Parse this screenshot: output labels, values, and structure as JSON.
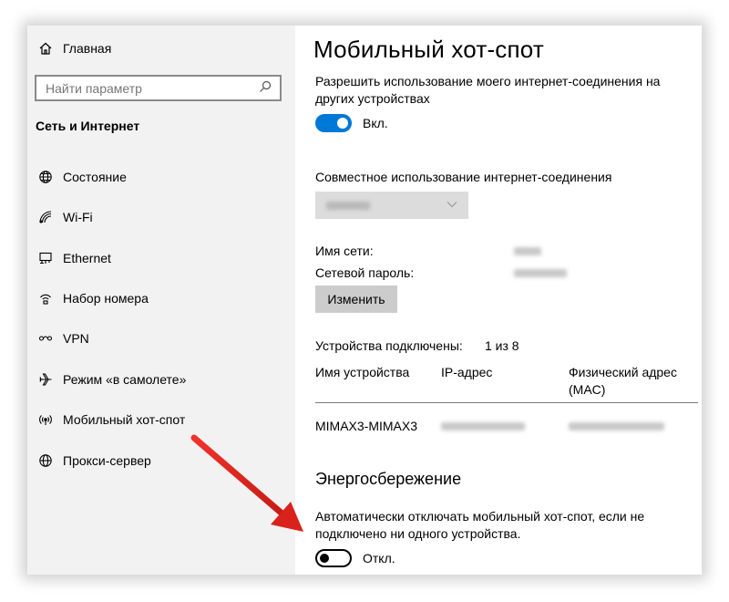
{
  "sidebar": {
    "home_label": "Главная",
    "search_placeholder": "Найти параметр",
    "section_title": "Сеть и Интернет",
    "items": [
      {
        "label": "Состояние",
        "icon": "globe-status-icon"
      },
      {
        "label": "Wi-Fi",
        "icon": "wifi-icon"
      },
      {
        "label": "Ethernet",
        "icon": "ethernet-icon"
      },
      {
        "label": "Набор номера",
        "icon": "dialup-icon"
      },
      {
        "label": "VPN",
        "icon": "vpn-icon"
      },
      {
        "label": "Режим «в самолете»",
        "icon": "airplane-icon"
      },
      {
        "label": "Мобильный хот-спот",
        "icon": "hotspot-icon"
      },
      {
        "label": "Прокси-сервер",
        "icon": "globe-proxy-icon"
      }
    ]
  },
  "content": {
    "title": "Мобильный хот-спот",
    "share_desc_line1": "Разрешить использование моего интернет-соединения на",
    "share_desc_line2": "других устройствах",
    "share_toggle_state": "Вкл.",
    "share_toggle_on": true,
    "connection_label": "Совместное использование интернет-соединения",
    "network_name_label": "Имя сети:",
    "password_label": "Сетевой пароль:",
    "edit_button": "Изменить",
    "devices_connected_label": "Устройства подключены:",
    "devices_connected_value": "1 из 8",
    "table": {
      "headers": [
        "Имя устройства",
        "IP-адрес",
        "Физический адрес",
        "(MAC)"
      ],
      "rows": [
        {
          "device": "MIMAX3-MIMAX3"
        }
      ]
    },
    "power_title": "Энергосбережение",
    "power_desc_line1": "Автоматически отключать мобильный хот-спот, если не",
    "power_desc_line2": "подключено ни одного устройства.",
    "power_toggle_state": "Откл.",
    "power_toggle_on": false
  },
  "colors": {
    "accent": "#0078d7",
    "annotation_arrow": "#e3201b",
    "sidebar_bg": "#f2f2f2"
  }
}
